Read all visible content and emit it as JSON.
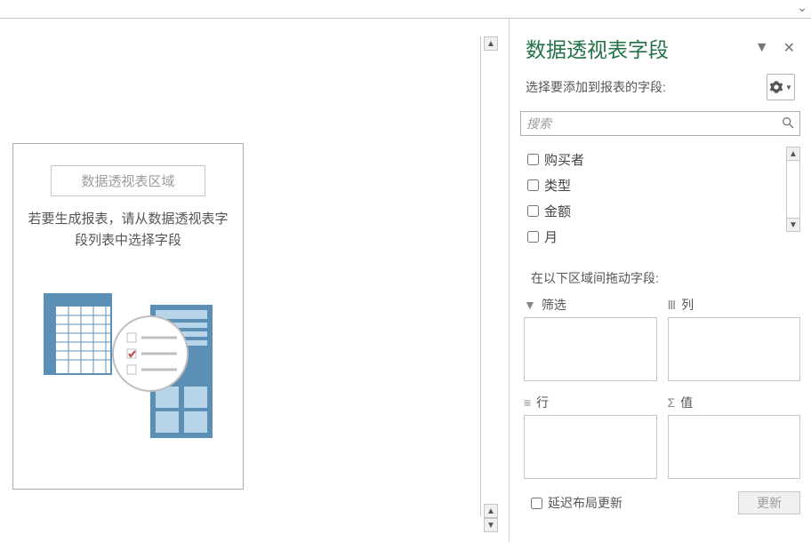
{
  "topbar": {
    "chevron": "⌄"
  },
  "placeholder": {
    "box_title": "数据透视表区域",
    "desc_line1": "若要生成报表，请从数据透视表字",
    "desc_line2": "段列表中选择字段"
  },
  "taskpane": {
    "title": "数据透视表字段",
    "sub": "选择要添加到报表的字段:",
    "search_placeholder": "搜索"
  },
  "fields": [
    {
      "label": "购买者"
    },
    {
      "label": "类型"
    },
    {
      "label": "金额"
    },
    {
      "label": "月"
    }
  ],
  "drag_hint": "在以下区域间拖动字段:",
  "areas": {
    "filter": "筛选",
    "columns": "列",
    "rows": "行",
    "values": "值"
  },
  "footer": {
    "defer": "延迟布局更新",
    "update": "更新"
  }
}
